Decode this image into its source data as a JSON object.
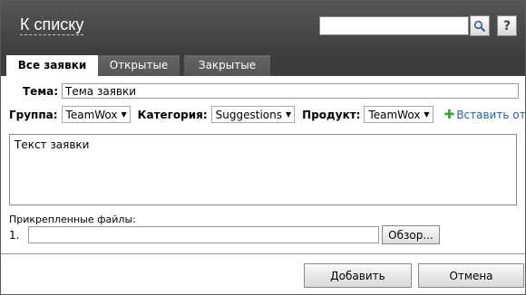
{
  "header": {
    "back_label": "К списку",
    "search_value": "",
    "help_label": "?"
  },
  "tabs": [
    {
      "label": "Все заявки",
      "active": true
    },
    {
      "label": "Открытые",
      "active": false
    },
    {
      "label": "Закрытые",
      "active": false
    }
  ],
  "form": {
    "theme_label": "Тема:",
    "theme_value": "Тема заявки",
    "group_label": "Группа:",
    "group_value": "TeamWox",
    "category_label": "Категория:",
    "category_value": "Suggestions",
    "product_label": "Продукт:",
    "product_value": "TeamWox",
    "add_report_label": "Вставить отчет",
    "body_text": "Текст заявки",
    "attachments_label": "Прикрепленные файлы:",
    "file_number": "1.",
    "browse_label": "Обзор..."
  },
  "actions": {
    "add_label": "Добавить",
    "cancel_label": "Отмена"
  },
  "colors": {
    "header_bg": "#4a4a4a",
    "tabbar_bg": "#3d3d3d",
    "link": "#1f5fa8",
    "plus": "#3aa33a"
  },
  "icons": {
    "search": "search-icon",
    "add_report": "plus-icon",
    "dropdown": "chevron-down-icon"
  }
}
